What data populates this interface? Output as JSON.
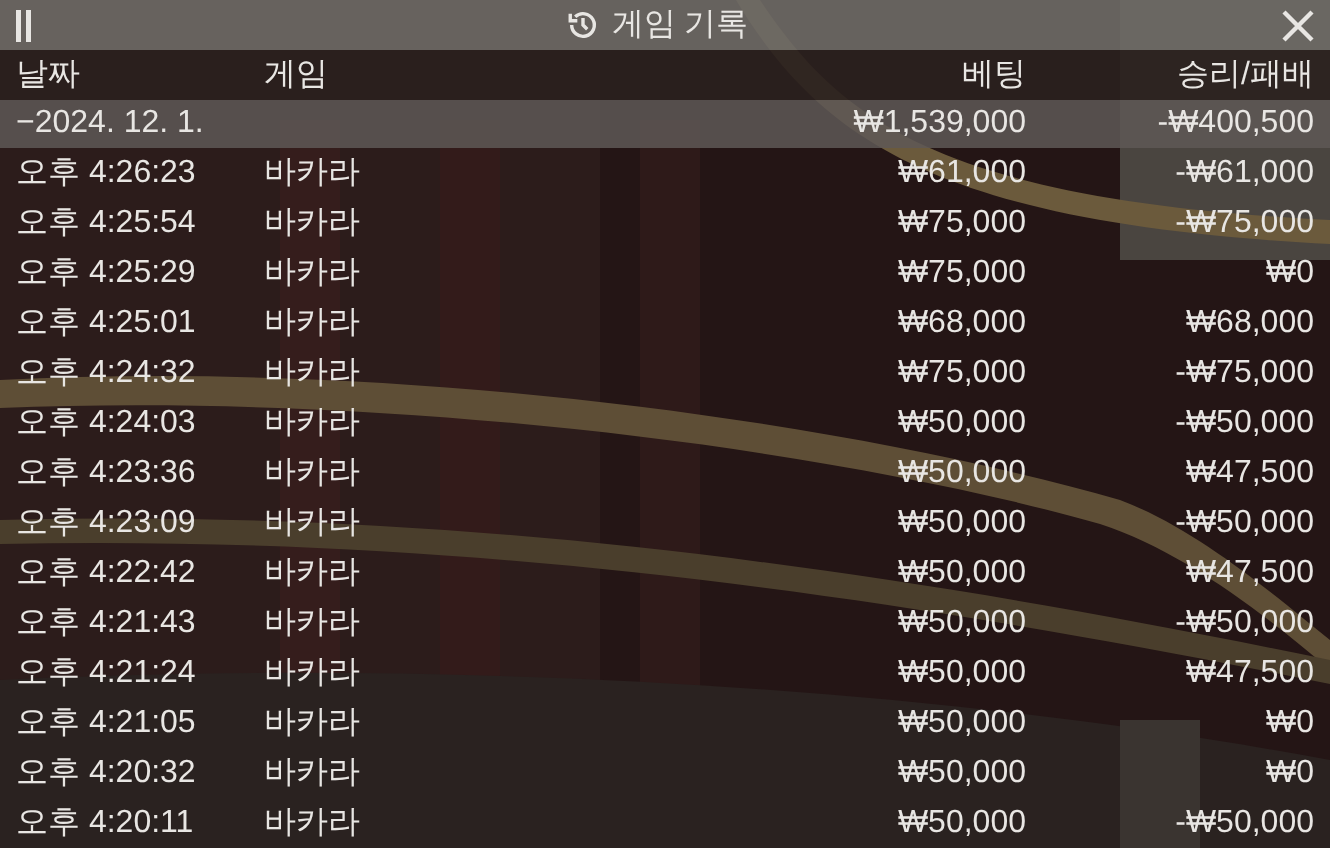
{
  "window": {
    "title": "게임 기록"
  },
  "table": {
    "columns": [
      "날짜",
      "게임",
      "베팅",
      "승리/패배"
    ],
    "group": {
      "date": "−2024. 12. 1.",
      "bet": "₩1,539,000",
      "result": "-₩400,500"
    },
    "rows": [
      {
        "time": "오후 4:26:23",
        "game": "바카라",
        "bet": "₩61,000",
        "result": "-₩61,000"
      },
      {
        "time": "오후 4:25:54",
        "game": "바카라",
        "bet": "₩75,000",
        "result": "-₩75,000"
      },
      {
        "time": "오후 4:25:29",
        "game": "바카라",
        "bet": "₩75,000",
        "result": "₩0"
      },
      {
        "time": "오후 4:25:01",
        "game": "바카라",
        "bet": "₩68,000",
        "result": "₩68,000"
      },
      {
        "time": "오후 4:24:32",
        "game": "바카라",
        "bet": "₩75,000",
        "result": "-₩75,000"
      },
      {
        "time": "오후 4:24:03",
        "game": "바카라",
        "bet": "₩50,000",
        "result": "-₩50,000"
      },
      {
        "time": "오후 4:23:36",
        "game": "바카라",
        "bet": "₩50,000",
        "result": "₩47,500"
      },
      {
        "time": "오후 4:23:09",
        "game": "바카라",
        "bet": "₩50,000",
        "result": "-₩50,000"
      },
      {
        "time": "오후 4:22:42",
        "game": "바카라",
        "bet": "₩50,000",
        "result": "₩47,500"
      },
      {
        "time": "오후 4:21:43",
        "game": "바카라",
        "bet": "₩50,000",
        "result": "-₩50,000"
      },
      {
        "time": "오후 4:21:24",
        "game": "바카라",
        "bet": "₩50,000",
        "result": "₩47,500"
      },
      {
        "time": "오후 4:21:05",
        "game": "바카라",
        "bet": "₩50,000",
        "result": "₩0"
      },
      {
        "time": "오후 4:20:32",
        "game": "바카라",
        "bet": "₩50,000",
        "result": "₩0"
      },
      {
        "time": "오후 4:20:11",
        "game": "바카라",
        "bet": "₩50,000",
        "result": "-₩50,000"
      }
    ]
  }
}
